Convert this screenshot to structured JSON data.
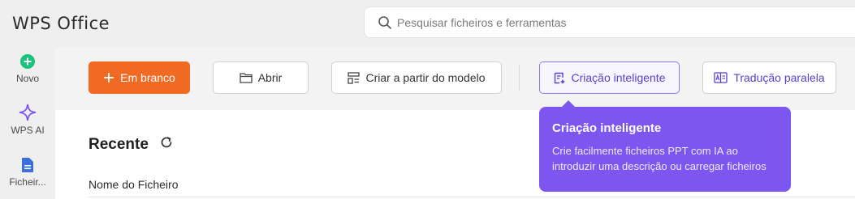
{
  "app": {
    "logo_text": "WPS Office"
  },
  "search": {
    "placeholder": "Pesquisar ficheiros e ferramentas",
    "icon": "search-icon"
  },
  "sidebar": {
    "items": [
      {
        "label": "Novo",
        "icon": "plus-circle-icon",
        "color": "#19c37d"
      },
      {
        "label": "WPS AI",
        "icon": "sparkle-icon",
        "color": "#7c56ef"
      },
      {
        "label": "Ficheir...",
        "icon": "file-icon",
        "color": "#3a6fe0"
      }
    ]
  },
  "toolbar": {
    "blank_label": "Em branco",
    "open_label": "Abrir",
    "template_label": "Criar a partir do modelo",
    "ai_label": "Criação inteligente",
    "translate_label": "Tradução paralela"
  },
  "recent": {
    "title": "Recente",
    "column_name": "Nome do Ficheiro"
  },
  "tooltip": {
    "title": "Criação inteligente",
    "body": "Crie facilmente ficheiros PPT com IA ao introduzir uma descrição ou carregar ficheiros"
  },
  "colors": {
    "accent": "#f06a23",
    "ai_purple": "#7c56ef"
  }
}
